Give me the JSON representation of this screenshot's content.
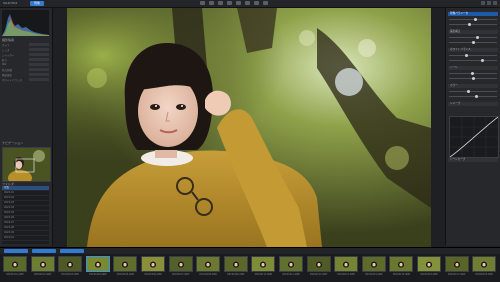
{
  "app": {
    "brand": "SILKYPIX",
    "active_tab": "現像"
  },
  "left_panel": {
    "histogram_label": "ヒストグラム",
    "sections": [
      "撮影情報",
      "ナビゲーション",
      "フォルダ"
    ],
    "info_rows": [
      "カメラ",
      "レンズ",
      "シャッター",
      "絞り",
      "ISO",
      "焦点距離",
      "露出補正",
      "ホワイトバランス"
    ],
    "folder_items": [
      "写真",
      "2024-01",
      "2024-02",
      "2024-03",
      "2024-04",
      "2024-05",
      "2024-06",
      "2024-07",
      "2024-08",
      "2024-09",
      "2024-10"
    ],
    "selected_folder_index": 0
  },
  "right_panel": {
    "headers": [
      "現像パラメータ",
      "露出補正",
      "ホワイトバランス",
      "トーン",
      "カラー",
      "シャープ",
      "トーンカーブ"
    ],
    "slider_levels": [
      0.55,
      0.42,
      0.6,
      0.5,
      0.35,
      0.7,
      0.48,
      0.52,
      0.4,
      0.58
    ]
  },
  "filmstrip": {
    "buttons": [
      "",
      "",
      ""
    ],
    "frames": [
      {
        "label": "DSC00101.ARW"
      },
      {
        "label": "DSC00102.ARW"
      },
      {
        "label": "DSC00103.ARW"
      },
      {
        "label": "DSC00104.ARW"
      },
      {
        "label": "DSC00105.ARW"
      },
      {
        "label": "DSC00106.ARW"
      },
      {
        "label": "DSC00107.ARW"
      },
      {
        "label": "DSC00108.ARW"
      },
      {
        "label": "DSC00109.ARW"
      },
      {
        "label": "DSC00110.ARW"
      },
      {
        "label": "DSC00111.ARW"
      },
      {
        "label": "DSC00112.ARW"
      },
      {
        "label": "DSC00113.ARW"
      },
      {
        "label": "DSC00114.ARW"
      },
      {
        "label": "DSC00115.ARW"
      },
      {
        "label": "DSC00116.ARW"
      },
      {
        "label": "DSC00117.ARW"
      },
      {
        "label": "DSC00118.ARW"
      }
    ],
    "selected_index": 3
  },
  "colors": {
    "accent": "#2f7bd6",
    "sweater": "#b8902a",
    "foliage": "#7a8a2e"
  }
}
